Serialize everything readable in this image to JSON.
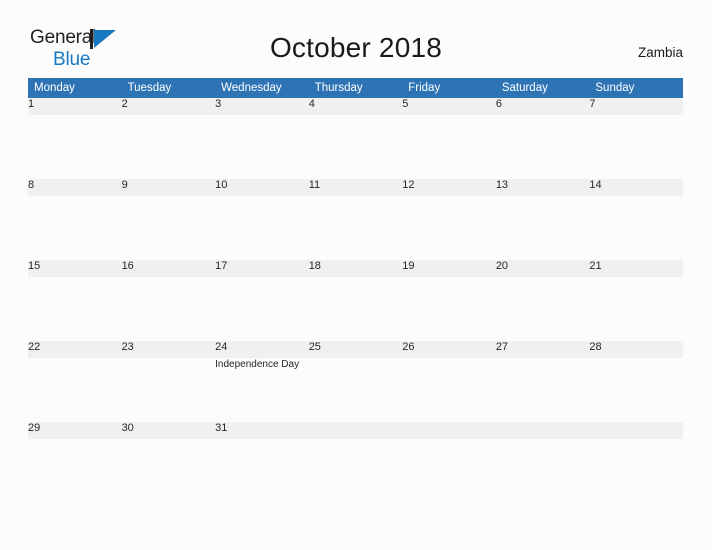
{
  "brand": {
    "word1": "General",
    "word2": "Blue",
    "mark_icon": "triangle-logo-icon",
    "color_dark": "#231f20",
    "color_blue": "#1878c0"
  },
  "header": {
    "title": "October 2018",
    "country": "Zambia"
  },
  "theme": {
    "header_blue": "#2e74b5",
    "daynum_band": "#f0f0f0",
    "page_background": "#fcfcfc",
    "text": "#262626"
  },
  "calendar": {
    "month": "October",
    "year": "2018",
    "weekday_headers": [
      "Monday",
      "Tuesday",
      "Wednesday",
      "Thursday",
      "Friday",
      "Saturday",
      "Sunday"
    ],
    "weeks": [
      {
        "days": [
          {
            "num": "1",
            "event": ""
          },
          {
            "num": "2",
            "event": ""
          },
          {
            "num": "3",
            "event": ""
          },
          {
            "num": "4",
            "event": ""
          },
          {
            "num": "5",
            "event": ""
          },
          {
            "num": "6",
            "event": ""
          },
          {
            "num": "7",
            "event": ""
          }
        ]
      },
      {
        "days": [
          {
            "num": "8",
            "event": ""
          },
          {
            "num": "9",
            "event": ""
          },
          {
            "num": "10",
            "event": ""
          },
          {
            "num": "11",
            "event": ""
          },
          {
            "num": "12",
            "event": ""
          },
          {
            "num": "13",
            "event": ""
          },
          {
            "num": "14",
            "event": ""
          }
        ]
      },
      {
        "days": [
          {
            "num": "15",
            "event": ""
          },
          {
            "num": "16",
            "event": ""
          },
          {
            "num": "17",
            "event": ""
          },
          {
            "num": "18",
            "event": ""
          },
          {
            "num": "19",
            "event": ""
          },
          {
            "num": "20",
            "event": ""
          },
          {
            "num": "21",
            "event": ""
          }
        ]
      },
      {
        "days": [
          {
            "num": "22",
            "event": ""
          },
          {
            "num": "23",
            "event": ""
          },
          {
            "num": "24",
            "event": "Independence Day"
          },
          {
            "num": "25",
            "event": ""
          },
          {
            "num": "26",
            "event": ""
          },
          {
            "num": "27",
            "event": ""
          },
          {
            "num": "28",
            "event": ""
          }
        ]
      },
      {
        "days": [
          {
            "num": "29",
            "event": ""
          },
          {
            "num": "30",
            "event": ""
          },
          {
            "num": "31",
            "event": ""
          },
          {
            "num": "",
            "event": ""
          },
          {
            "num": "",
            "event": ""
          },
          {
            "num": "",
            "event": ""
          },
          {
            "num": "",
            "event": ""
          }
        ]
      }
    ]
  }
}
